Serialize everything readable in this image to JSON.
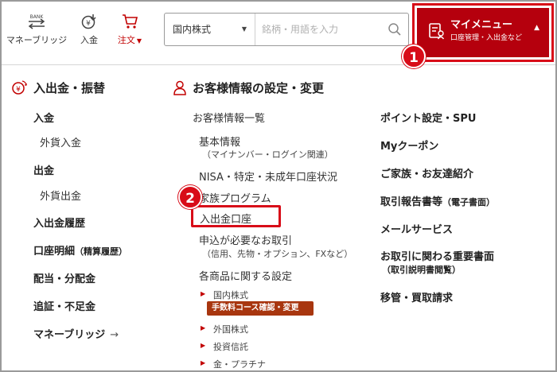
{
  "topbar": {
    "nav": [
      {
        "icon": "money-bridge-icon",
        "label": "マネーブリッジ",
        "icon_text": "BANK"
      },
      {
        "icon": "deposit-icon",
        "label": "入金"
      },
      {
        "icon": "cart-icon",
        "label": "注文",
        "caret": "▼"
      }
    ],
    "search": {
      "market_value": "国内株式",
      "market_caret": "▼",
      "placeholder": "銘柄・用語を入力"
    },
    "mymenu": {
      "title": "マイメニュー",
      "subtitle": "口座管理・入出金など",
      "caret": "▲"
    }
  },
  "badges": {
    "one": "1",
    "two": "2"
  },
  "sections": {
    "deposit": {
      "heading": "入出金・振替",
      "items": {
        "nyukin": "入金",
        "gaika_nyukin": "外貨入金",
        "shukkin": "出金",
        "gaika_shukkin": "外貨出金",
        "rireki": "入出金履歴",
        "meisai": "口座明細",
        "meisai_note": "（精算履歴）",
        "haito": "配当・分配金",
        "tsuisho": "追証・不足金",
        "money_bridge": "マネーブリッジ",
        "money_bridge_arrow": "→"
      }
    },
    "customer": {
      "heading": "お客様情報の設定・変更",
      "items": {
        "ichiran": "お客様情報一覧",
        "kihon": "基本情報",
        "kihon_sub": "（マイナンバー・ログイン関連）",
        "nisa": "NISA・特定・未成年口座状況",
        "kazoku": "家族プログラム",
        "nyukin_koza": "入出金口座",
        "moshikomi": "申込が必要なお取引",
        "moshikomi_sub": "（信用、先物・オプション、FXなど）",
        "kaku_shohin": "各商品に関する設定",
        "kokunai": "国内株式",
        "tesuryo": "手数料コース確認・変更",
        "gaikoku": "外国株式",
        "toshin": "投資信託",
        "kin": "金・プラチナ"
      }
    },
    "other": {
      "items": {
        "point": "ポイント設定・SPU",
        "mycoupon": "Myクーポン",
        "kazoku_shokai": "ご家族・お友達紹介",
        "torihiki_hokoku": "取引報告書等",
        "torihiki_hokoku_note": "（電子書面）",
        "mail": "メールサービス",
        "juyo_shomen": "お取引に関わる重要書面",
        "juyo_shomen_sub": "（取引説明書閲覧）",
        "ikan": "移管・買取請求"
      }
    }
  },
  "colors": {
    "brand_red": "#b5000d",
    "highlight_red": "#d80c18",
    "tag_orange": "#a8360f"
  }
}
